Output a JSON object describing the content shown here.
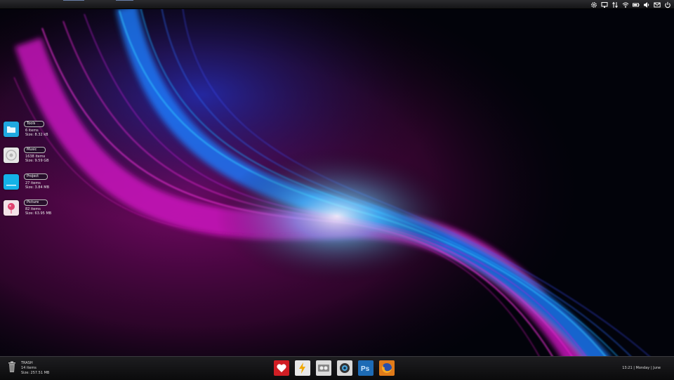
{
  "desktop_icons": [
    {
      "title": "Tools",
      "line1": "6 items",
      "line2": "Size: 8.32 kB",
      "color": "#1fa8e0"
    },
    {
      "title": "Music",
      "line1": "1638 items",
      "line2": "Size: 9.59 GB",
      "color": "#e6e6e6"
    },
    {
      "title": "Project",
      "line1": "27 items",
      "line2": "Size: 3.84 MB",
      "color": "#14b2e8"
    },
    {
      "title": "Picture",
      "line1": "82 items",
      "line2": "Size: 63.95 MB",
      "color": "#f3e3e8"
    }
  ],
  "trash": {
    "title": "TRASH",
    "line1": "14 items",
    "line2": "Size: 257.51 MB"
  },
  "clock": {
    "text": "13:21 | Monday | June"
  },
  "tray_icons": [
    "gear-icon",
    "monitor-icon",
    "network-arrows-icon",
    "wifi-icon",
    "battery-icon",
    "volume-icon",
    "mail-icon",
    "power-icon"
  ],
  "dock_apps": [
    {
      "icon": "heart-app-icon",
      "color": "#d01e24"
    },
    {
      "icon": "lightning-app-icon",
      "color": "#e8e8e8"
    },
    {
      "icon": "tape-app-icon",
      "color": "#dcdcdc"
    },
    {
      "icon": "webcam-app-icon",
      "color": "#d8d8d8"
    },
    {
      "icon": "photoshop-icon",
      "color": "#1d6bb5"
    },
    {
      "icon": "firefox-icon",
      "color": "#e07b1a"
    }
  ],
  "colors": {
    "magenta": "#e51ad2",
    "cyan": "#1ed6ff",
    "blue": "#1a4bff"
  }
}
